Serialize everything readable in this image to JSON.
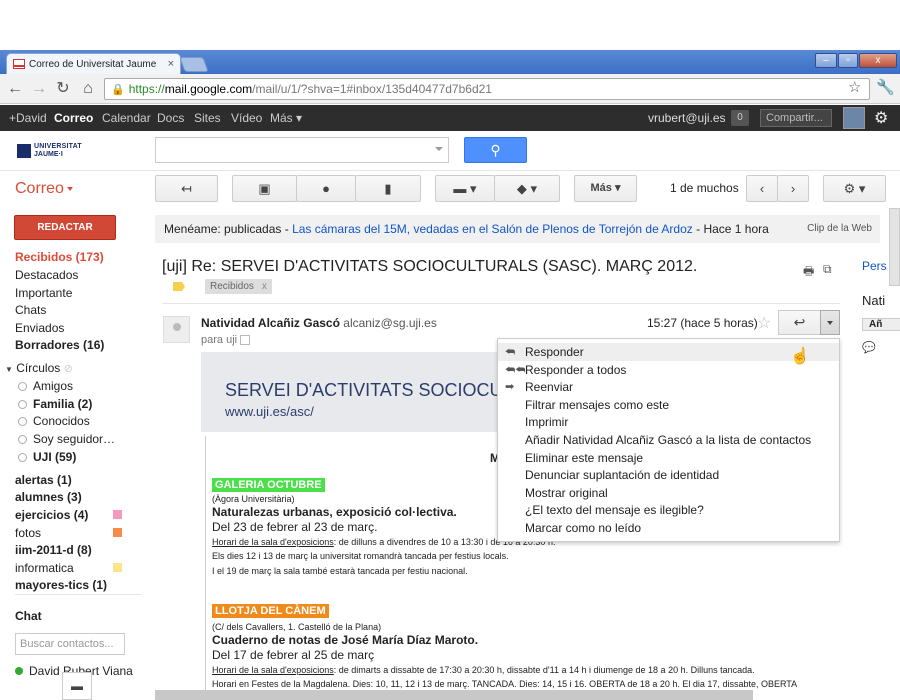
{
  "browser": {
    "tab_title": "Correo de Universitat Jaume I",
    "url_https": "https://",
    "url_host": "mail.google.com",
    "url_path": "/mail/u/1/?shva=1#inbox/135d40477d7b6d21"
  },
  "gbar": {
    "items": [
      "+David",
      "Correo",
      "Calendar",
      "Docs",
      "Sites",
      "Vídeo",
      "Más"
    ],
    "user": "vrubert@uji.es",
    "count": "0",
    "share": "Compartir..."
  },
  "header": {
    "logo_line1": "UNIVERSITAT",
    "logo_line2": "JAUME·I"
  },
  "nav": {
    "app_title": "Correo",
    "compose": "REDACTAR",
    "items": [
      {
        "label": "Recibidos (173)",
        "style": "red"
      },
      {
        "label": "Destacados",
        "style": ""
      },
      {
        "label": "Importante",
        "style": ""
      },
      {
        "label": "Chats",
        "style": ""
      },
      {
        "label": "Enviados",
        "style": ""
      },
      {
        "label": "Borradores (16)",
        "style": "bold"
      }
    ],
    "circles_title": "Círculos",
    "circles": [
      {
        "label": "Amigos",
        "bold": false
      },
      {
        "label": "Familia (2)",
        "bold": true
      },
      {
        "label": "Conocidos",
        "bold": false
      },
      {
        "label": "Soy seguidor…",
        "bold": false
      },
      {
        "label": "UJI (59)",
        "bold": true
      }
    ],
    "labels": [
      {
        "label": "alertas (1)",
        "bold": true,
        "color": ""
      },
      {
        "label": "alumnes (3)",
        "bold": true,
        "color": ""
      },
      {
        "label": "ejercicios (4)",
        "bold": true,
        "color": "#f49ac1"
      },
      {
        "label": "fotos",
        "bold": false,
        "color": "#f78b4a"
      },
      {
        "label": "iim-2011-d (8)",
        "bold": true,
        "color": ""
      },
      {
        "label": "informatica",
        "bold": false,
        "color": "#f8e58c"
      },
      {
        "label": "mayores-tics (1)",
        "bold": true,
        "color": ""
      }
    ],
    "chat_title": "Chat",
    "chat_search_placeholder": "Buscar contactos...",
    "chat_user": "David Rubert Viana"
  },
  "toolbar": {
    "more": "Más",
    "pager": "1 de muchos"
  },
  "clip": {
    "prefix": "Menéame: publicadas - ",
    "link": "Las cámaras del 15M, vedadas en el Salón de Plenos de Torrejón de Ardoz",
    "suffix": " - Hace 1 hora",
    "right": "Clip de la Web"
  },
  "message": {
    "subject": "[uji] Re: SERVEI D'ACTIVITATS SOCIOCULTURALS (SASC). MARÇ 2012.",
    "label": "Recibidos",
    "label_close": "x",
    "sender_name": "Natividad Alcañiz Gascó",
    "sender_email": "alcaniz@sg.uji.es",
    "to": "para uji",
    "time": "15:27 (hace 5 horas)"
  },
  "right_panel": {
    "l1": "Pers",
    "l2": "Nati",
    "l3": "Añ"
  },
  "body": {
    "banner_title": "SERVEI D'ACTIVITATS SOCIOCUL",
    "banner_url": "www.uji.es/asc/",
    "M": "M",
    "s1_title": "GALERIA OCTUBRE",
    "s1_place": "(Àgora Universitària)",
    "s1_heading": "Naturalezas urbanas, exposició col·lectiva.",
    "s1_dates": "Del 23 de febrer al 23 de març.",
    "s1_hours_label": "Horari de la sala d'exposicions",
    "s1_hours": ": de dilluns a divendres de 10 a 13:30 i de 16 a 20:30 h.",
    "s1_note1": "Els dies 12 i 13 de març la universitat romandrà tancada per festius locals.",
    "s1_note2": "I el 19 de març la sala també estarà tancada per festiu nacional.",
    "s2_title": "LLOTJA DEL CÀNEM",
    "s2_place": "(C/ dels Cavallers, 1. Castelló de la Plana)",
    "s2_heading": "Cuaderno de notas de José María Díaz Maroto.",
    "s2_dates": "Del 17 de febrer al 25 de març",
    "s2_hours_label": "Horari de la sala d'exposicions",
    "s2_hours": ": de dimarts a dissabte de 17:30 a 20:30 h, dissabte d'11 a 14 h i diumenge de 18 a 20 h. Dilluns tancada.",
    "s2_note1": "Horari en Festes de la Magdalena. Dies: 10, 11, 12 i 13 de març. TANCADA. Dies: 14, 15 i 16. OBERTA de 18 a 20 h. El dia 17, dissabte, OBERTA"
  },
  "menu": {
    "items": [
      {
        "label": "Responder",
        "icon": "reply-icon"
      },
      {
        "label": "Responder a todos",
        "icon": "reply-all-icon"
      },
      {
        "label": "Reenviar",
        "icon": "forward-icon"
      },
      {
        "label": "Filtrar mensajes como este",
        "icon": ""
      },
      {
        "label": "Imprimir",
        "icon": ""
      },
      {
        "label": "Añadir Natividad Alcañiz Gascó a la lista de contactos",
        "icon": ""
      },
      {
        "label": "Eliminar este mensaje",
        "icon": ""
      },
      {
        "label": "Denunciar suplantación de identidad",
        "icon": ""
      },
      {
        "label": "Mostrar original",
        "icon": ""
      },
      {
        "label": "¿El texto del mensaje es ilegible?",
        "icon": ""
      },
      {
        "label": "Marcar como no leído",
        "icon": ""
      }
    ]
  }
}
